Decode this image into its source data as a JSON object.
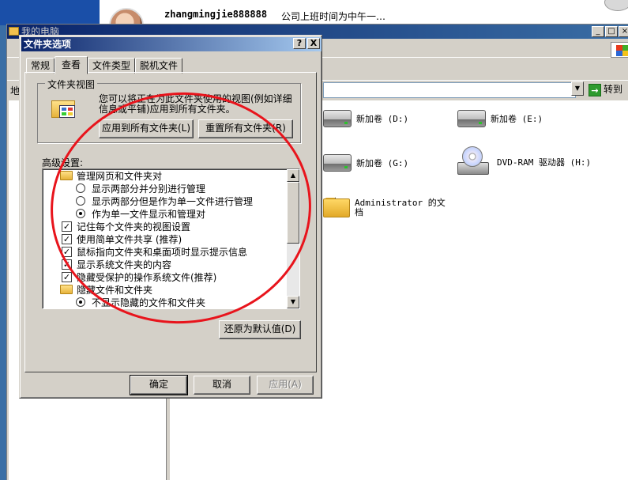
{
  "chat": {
    "username": "zhangmingjie888888",
    "message": "公司上班时间为中午一…"
  },
  "explorer": {
    "title": "我的电脑",
    "go_label": "转到",
    "address_label": "地",
    "drives": [
      {
        "label": "新加卷 (D:)"
      },
      {
        "label": "新加卷 (E:)"
      },
      {
        "label": "新加卷 (G:)"
      },
      {
        "label": "DVD-RAM 驱动器 (H:)"
      }
    ],
    "folder": {
      "label_line1": "Administrator 的文",
      "label_line2": "档"
    }
  },
  "dialog": {
    "title": "文件夹选项",
    "help_btn": "?",
    "close_btn": "X",
    "tabs": [
      "常规",
      "查看",
      "文件类型",
      "脱机文件"
    ],
    "active_tab": "查看",
    "folder_view": {
      "group_label": "文件夹视图",
      "description_line1": "您可以将正在为此文件夹使用的视图(例如详细",
      "description_line2": "信息或平铺)应用到所有文件夹。",
      "apply_all_button": "应用到所有文件夹(L)",
      "reset_all_button": "重置所有文件夹(R)"
    },
    "advanced_label": "高级设置:",
    "advanced_items": [
      {
        "type": "folder",
        "label": "管理网页和文件夹对"
      },
      {
        "type": "radio",
        "checked": false,
        "label": "显示两部分并分别进行管理"
      },
      {
        "type": "radio",
        "checked": false,
        "label": "显示两部分但是作为单一文件进行管理"
      },
      {
        "type": "radio",
        "checked": true,
        "label": "作为单一文件显示和管理对"
      },
      {
        "type": "checkbox",
        "checked": true,
        "label": "记住每个文件夹的视图设置"
      },
      {
        "type": "checkbox",
        "checked": true,
        "label": "使用简单文件共享 (推荐)"
      },
      {
        "type": "checkbox",
        "checked": true,
        "label": "鼠标指向文件夹和桌面项时显示提示信息"
      },
      {
        "type": "checkbox",
        "checked": true,
        "label": "显示系统文件夹的内容"
      },
      {
        "type": "checkbox",
        "checked": true,
        "label": "隐藏受保护的操作系统文件(推荐)"
      },
      {
        "type": "folder",
        "label": "隐藏文件和文件夹"
      },
      {
        "type": "radio",
        "checked": true,
        "label": "不显示隐藏的文件和文件夹"
      }
    ],
    "restore_defaults_button": "还原为默认值(D)",
    "ok_button": "确定",
    "cancel_button": "取消",
    "apply_button": "应用(A)"
  },
  "colors": {
    "annotation_circle": "#e8141c",
    "title_gradient_start": "#0a246a",
    "window_face": "#d4d0c8"
  }
}
